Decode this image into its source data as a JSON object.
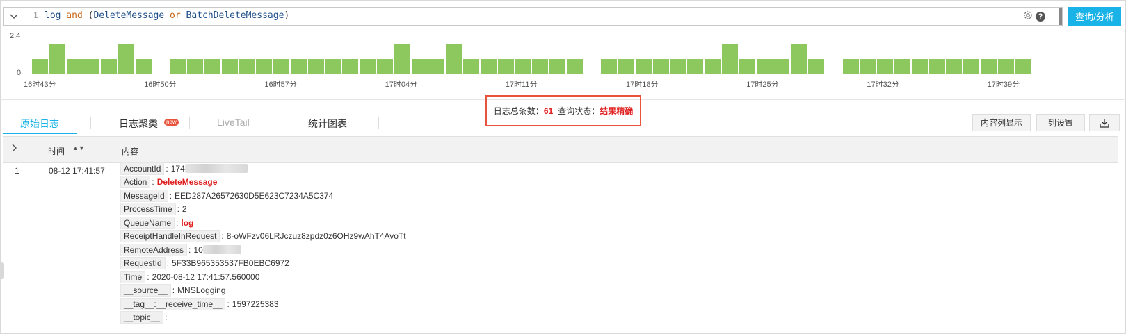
{
  "query": {
    "line_number": "1",
    "tokens": [
      {
        "text": "log",
        "kind": "plain"
      },
      {
        "text": " and ",
        "kind": "kw"
      },
      {
        "text": "(",
        "kind": "paren"
      },
      {
        "text": "DeleteMessage",
        "kind": "plain"
      },
      {
        "text": " or ",
        "kind": "kw"
      },
      {
        "text": "BatchDeleteMessage",
        "kind": "plain"
      },
      {
        "text": ")",
        "kind": "paren"
      }
    ],
    "help_glyph": "?",
    "submit_label": "查询/分析"
  },
  "histogram": {
    "y_max_label": "2.4",
    "y_min_label": "0",
    "x_ticks": [
      "16时43分",
      "16时50分",
      "16时57分",
      "17时04分",
      "17时11分",
      "17时18分",
      "17时25分",
      "17时32分",
      "17时39分"
    ],
    "counts": [
      1,
      2,
      1,
      1,
      1,
      2,
      1,
      0,
      1,
      1,
      1,
      1,
      1,
      1,
      1,
      1,
      1,
      1,
      1,
      1,
      1,
      2,
      1,
      1,
      2,
      1,
      1,
      1,
      1,
      1,
      1,
      1,
      0,
      1,
      1,
      1,
      1,
      1,
      1,
      1,
      2,
      1,
      1,
      1,
      2,
      1,
      0,
      1,
      1,
      1,
      1,
      1,
      1,
      1,
      1,
      1,
      1,
      1
    ],
    "bar_color": "#8cc85e"
  },
  "status": {
    "total_label": "日志总条数：",
    "total": "61",
    "state_label": "查询状态：",
    "state": "结果精确"
  },
  "tabs": [
    {
      "label": "原始日志",
      "state": "active"
    },
    {
      "label": "日志聚类",
      "state": "normal",
      "badge": "new"
    },
    {
      "label": "LiveTail",
      "state": "disabled"
    },
    {
      "label": "统计图表",
      "state": "normal"
    }
  ],
  "toolbar": {
    "content_column_label": "内容列显示",
    "column_settings_label": "列设置"
  },
  "table": {
    "header_time": "时间",
    "header_content": "内容",
    "sort_glyph": "▲▼",
    "rows": [
      {
        "index": "1",
        "time": "08-12 17:41:57",
        "fields": [
          {
            "key": "AccountId",
            "value": "174",
            "blur": 90
          },
          {
            "key": "Action",
            "value": "DeleteMessage",
            "highlight": true
          },
          {
            "key": "MessageId",
            "value": "EED287A26572630D5E623C7234A5C374"
          },
          {
            "key": "ProcessTime",
            "value": "2"
          },
          {
            "key": "QueueName",
            "value": "log",
            "highlight": true
          },
          {
            "key": "ReceiptHandleInRequest",
            "value": "8-oWFzv06LRJczuz8zpdz0z6OHz9wAhT4AvoTt"
          },
          {
            "key": "RemoteAddress",
            "value": "10",
            "blur": 55
          },
          {
            "key": "RequestId",
            "value": "5F33B965353537FB0EBC6972"
          },
          {
            "key": "Time",
            "value": "2020-08-12 17:41:57.560000"
          },
          {
            "key": "__source__",
            "value": "MNSLogging"
          },
          {
            "key": "__tag__:__receive_time__",
            "value": "1597225383"
          },
          {
            "key": "__topic__",
            "value": ""
          }
        ]
      }
    ]
  }
}
